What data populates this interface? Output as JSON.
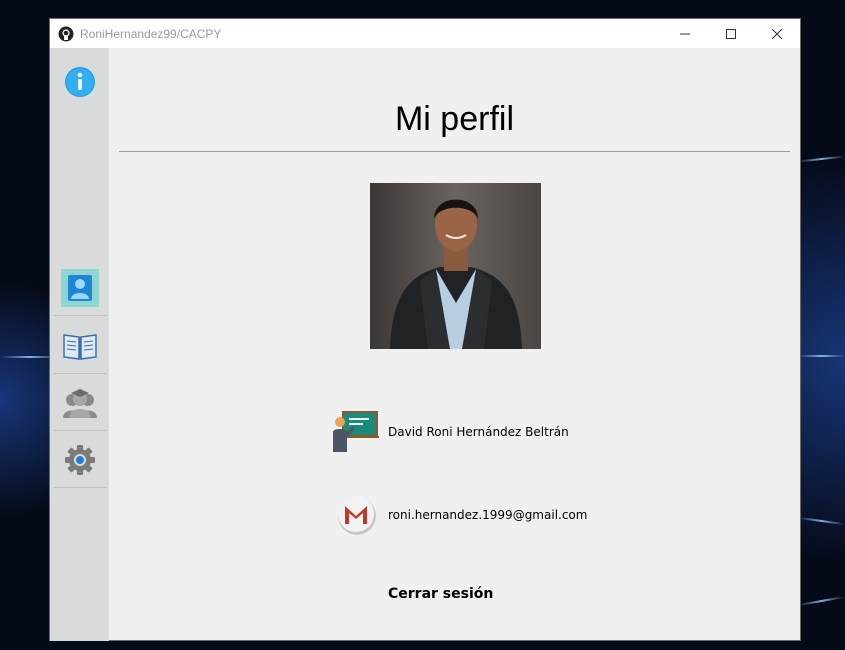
{
  "window": {
    "title": "RoniHernandez99/CACPY"
  },
  "sidebar": {
    "items": [
      {
        "name": "info",
        "icon": "info-icon"
      },
      {
        "name": "profile",
        "icon": "user-profile-icon",
        "active": true
      },
      {
        "name": "courses",
        "icon": "open-book-icon"
      },
      {
        "name": "students",
        "icon": "graduates-icon"
      },
      {
        "name": "settings",
        "icon": "gear-icon"
      }
    ]
  },
  "main": {
    "title": "Mi perfil",
    "profile": {
      "full_name": "David Roni Hernández Beltrán",
      "email": "roni.hernandez.1999@gmail.com"
    },
    "logout_label": "Cerrar sesión"
  },
  "colors": {
    "window_bg": "#f0f0f0",
    "sidebar_bg": "#d9dbda",
    "active_item_bg": "#8fd6d1",
    "info_blue": "#1a9ee2",
    "gmail_red": "#c0392b"
  }
}
